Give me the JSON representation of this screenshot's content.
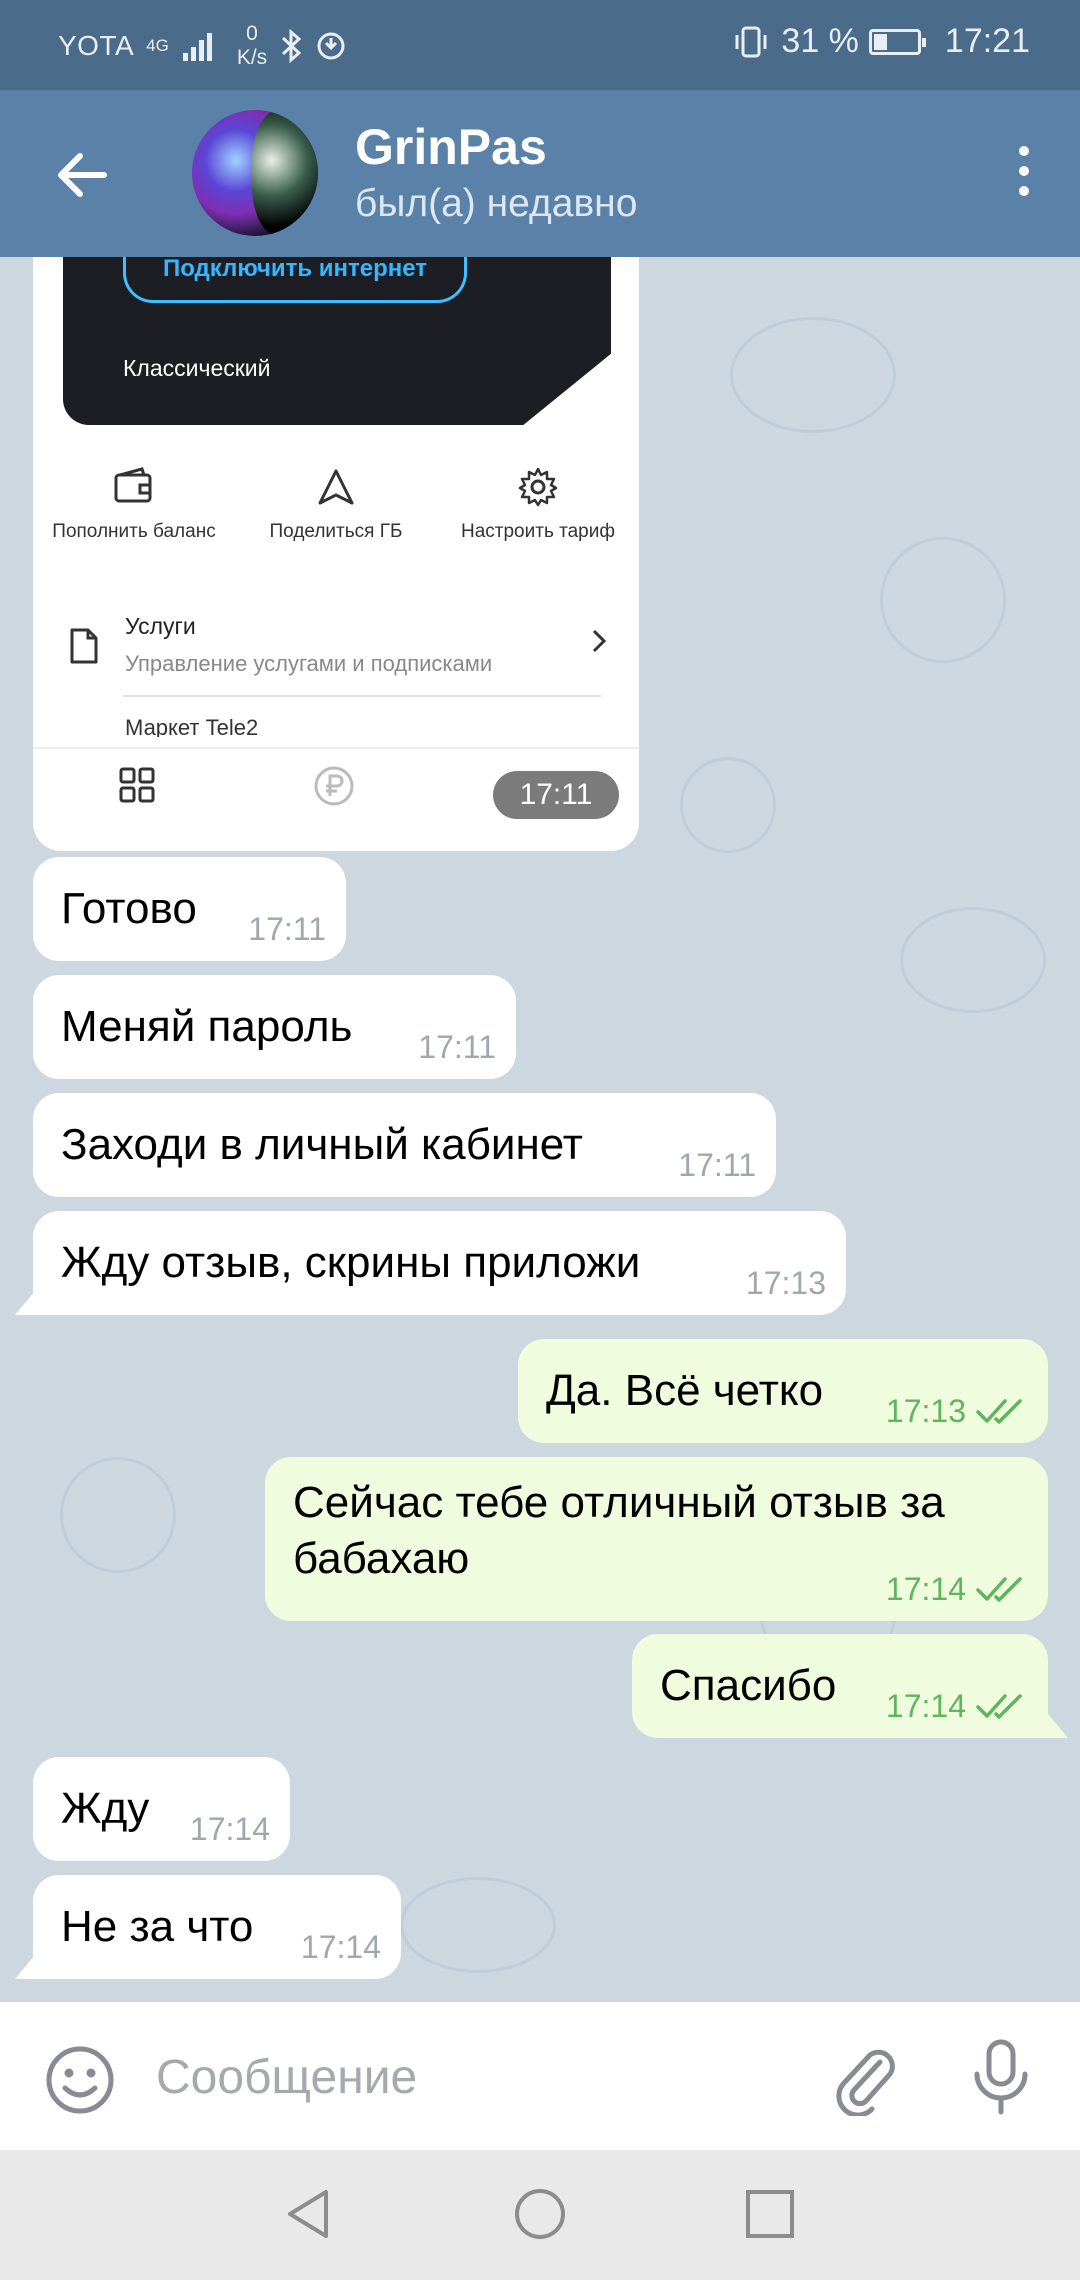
{
  "status_bar": {
    "carrier": "YOTA",
    "network": "4G",
    "speed_value": "0",
    "speed_unit": "K/s",
    "battery": "31 %",
    "battery_level": 0.31,
    "time": "17:21"
  },
  "header": {
    "title": "GrinPas",
    "subtitle": "был(а) недавно",
    "back_icon": "arrow-left-icon",
    "menu_icon": "more-vert-icon"
  },
  "media_message": {
    "connect_button": "Подключить интернет",
    "plan": "Классический",
    "actions": [
      {
        "label": "Пополнить баланс",
        "icon": "wallet-icon"
      },
      {
        "label": "Поделиться ГБ",
        "icon": "share-triangle-icon"
      },
      {
        "label": "Настроить тариф",
        "icon": "gear-icon"
      }
    ],
    "services_title": "Услуги",
    "services_subtitle": "Управление услугами и подписками",
    "market": "Маркет Tele2",
    "time": "17:11"
  },
  "messages": [
    {
      "text": "Готово",
      "time": "17:11",
      "direction": "in"
    },
    {
      "text": "Меняй пароль",
      "time": "17:11",
      "direction": "in"
    },
    {
      "text": "Заходи в личный кабинет",
      "time": "17:11",
      "direction": "in"
    },
    {
      "text": "Жду отзыв, скрины приложи",
      "time": "17:13",
      "direction": "in"
    },
    {
      "text": "Да. Всё четко",
      "time": "17:13",
      "direction": "out"
    },
    {
      "text": "Сейчас тебе отличный отзыв за бабахаю",
      "time": "17:14",
      "direction": "out"
    },
    {
      "text": "Спасибо",
      "time": "17:14",
      "direction": "out"
    },
    {
      "text": "Жду",
      "time": "17:14",
      "direction": "in"
    },
    {
      "text": "Не за что",
      "time": "17:14",
      "direction": "in"
    }
  ],
  "input": {
    "placeholder": "Сообщение",
    "emoji_icon": "emoji-icon",
    "attach_icon": "paperclip-icon",
    "mic_icon": "microphone-icon"
  },
  "colors": {
    "header": "#5a82a8",
    "status_bar": "#4a6b8a",
    "chat_background": "#cdd7e0",
    "outgoing_bubble": "#effdde",
    "incoming_bubble": "#ffffff",
    "read_ticks": "#5fb55b"
  }
}
